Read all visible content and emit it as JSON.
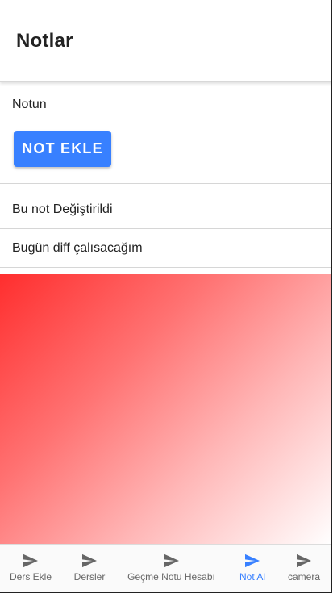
{
  "toolbar": {
    "title": "Notlar"
  },
  "form": {
    "input_placeholder": "Notun",
    "input_value": "",
    "add_button_label": "NOT EKLE"
  },
  "notes": [
    {
      "text": "Bu not Değiştirildi"
    },
    {
      "text": "Bugün diff çalısacağım"
    }
  ],
  "colors": {
    "accent": "#3880ff",
    "gradient_start": "#ff2e2e",
    "gradient_end": "#ffffff",
    "tab_inactive": "#666666"
  },
  "tabs": [
    {
      "label": "Ders Ekle",
      "icon": "send-icon",
      "active": false
    },
    {
      "label": "Dersler",
      "icon": "send-icon",
      "active": false
    },
    {
      "label": "Geçme Notu Hesabı",
      "icon": "send-icon",
      "active": false
    },
    {
      "label": "Not Al",
      "icon": "send-icon",
      "active": true
    },
    {
      "label": "camera",
      "icon": "send-icon",
      "active": false
    }
  ]
}
